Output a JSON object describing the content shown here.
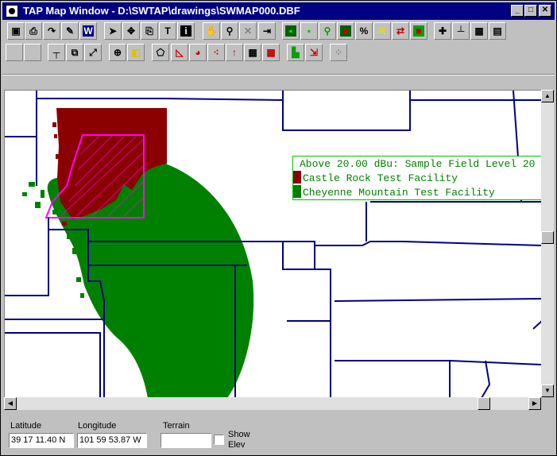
{
  "window": {
    "title": "TAP Map Window - D:\\SWTAP\\drawings\\SWMAP000.DBF",
    "minimize": "_",
    "maximize": "□",
    "close": "✕"
  },
  "toolbar1": [
    {
      "name": "save-icon",
      "glyph": "▣",
      "color": "#000000"
    },
    {
      "name": "print-icon",
      "glyph": "⎙",
      "color": "#000000"
    },
    {
      "name": "redo-arrow-icon",
      "glyph": "↷",
      "color": "#000000"
    },
    {
      "name": "edit-icon",
      "glyph": "✎",
      "color": "#000000"
    },
    {
      "name": "w-icon",
      "glyph": "W",
      "color": "#ffffff",
      "bg": "#000080"
    },
    {
      "name": "pointer-icon",
      "glyph": "➤",
      "color": "#000000"
    },
    {
      "name": "move-icon",
      "glyph": "✥",
      "color": "#000000"
    },
    {
      "name": "copy-icon",
      "glyph": "⎘",
      "color": "#000000"
    },
    {
      "name": "text-icon",
      "glyph": "T",
      "color": "#000000"
    },
    {
      "name": "info-icon",
      "glyph": "i",
      "color": "#ffffff",
      "bg": "#000000"
    },
    {
      "name": "hand-icon",
      "glyph": "✋",
      "color": "#000000"
    },
    {
      "name": "search-icon",
      "glyph": "⚲",
      "color": "#000000"
    },
    {
      "name": "delete-icon",
      "glyph": "✕",
      "color": "#808080"
    },
    {
      "name": "exit-icon",
      "glyph": "⇥",
      "color": "#000000"
    },
    {
      "name": "green-icon-1",
      "glyph": "▪",
      "color": "#00ff00",
      "bg": "#006000"
    },
    {
      "name": "green-icon-2",
      "glyph": "▪",
      "color": "#00c000"
    },
    {
      "name": "pin-icon",
      "glyph": "⚲",
      "color": "#00a000"
    },
    {
      "name": "red-square-icon",
      "glyph": "■",
      "color": "#c00000",
      "bg": "#006000"
    },
    {
      "name": "percent-icon",
      "glyph": "%",
      "color": "#000000"
    },
    {
      "name": "r-icon",
      "glyph": "R",
      "color": "#e0e000"
    },
    {
      "name": "swap-icon",
      "glyph": "⇄",
      "color": "#c00000"
    },
    {
      "name": "stop-icon",
      "glyph": "■",
      "color": "#c00000",
      "bg": "#00a000"
    },
    {
      "name": "plus-icon",
      "glyph": "✚",
      "color": "#000000"
    },
    {
      "name": "ruler-icon",
      "glyph": "┴",
      "color": "#000000"
    },
    {
      "name": "grid-icon",
      "glyph": "▦",
      "color": "#000000"
    },
    {
      "name": "notepad-icon",
      "glyph": "▤",
      "color": "#000000"
    }
  ],
  "toolbar2": [
    {
      "name": "blank-icon-1",
      "glyph": "",
      "color": "#000000"
    },
    {
      "name": "blank-icon-2",
      "glyph": "",
      "color": "#000000"
    },
    {
      "name": "line-tool-icon",
      "glyph": "┬",
      "color": "#000000"
    },
    {
      "name": "zoom-box-icon",
      "glyph": "⧉",
      "color": "#000000"
    },
    {
      "name": "resize-icon",
      "glyph": "⤢",
      "color": "#000000"
    },
    {
      "name": "crosshair-icon",
      "glyph": "⊕",
      "color": "#000000"
    },
    {
      "name": "layers-icon",
      "glyph": "◧",
      "color": "#e0c000"
    },
    {
      "name": "polygon-icon",
      "glyph": "⬠",
      "color": "#000000"
    },
    {
      "name": "area-icon",
      "glyph": "◺",
      "color": "#c00000"
    },
    {
      "name": "pie-icon",
      "glyph": "◕",
      "color": "#c00000"
    },
    {
      "name": "scatter-icon",
      "glyph": "⁖",
      "color": "#c00000"
    },
    {
      "name": "arrow-up-icon",
      "glyph": "↑",
      "color": "#c00000"
    },
    {
      "name": "matrix-icon",
      "glyph": "▦",
      "color": "#000000"
    },
    {
      "name": "matrix-color-icon",
      "glyph": "▦",
      "color": "#c00000"
    },
    {
      "name": "histogram-icon",
      "glyph": "▙",
      "color": "#00a000"
    },
    {
      "name": "transfer-icon",
      "glyph": "⇲",
      "color": "#c00000"
    },
    {
      "name": "disabled-grid-icon",
      "glyph": "⁘",
      "color": "#808080"
    }
  ],
  "legend": {
    "title": "Above 20.00 dBu: Sample Field Level 20",
    "entries": [
      {
        "label": "Castle Rock Test Facility",
        "color": "#8b0000"
      },
      {
        "label": "Cheyenne Mountain Test Facility",
        "color": "#008000"
      }
    ]
  },
  "status": {
    "latitude_label": "Latitude",
    "latitude_value": "39 17 11.40 N",
    "longitude_label": "Longitude",
    "longitude_value": "101 59 53.87 W",
    "terrain_label": "Terrain",
    "terrain_value": "",
    "show_elev_label_1": "Show",
    "show_elev_label_2": "Elev"
  },
  "colors": {
    "boundary": "#000080",
    "coverage_green": "#008000",
    "coverage_red": "#8b0000",
    "selection": "#ff00ff"
  }
}
